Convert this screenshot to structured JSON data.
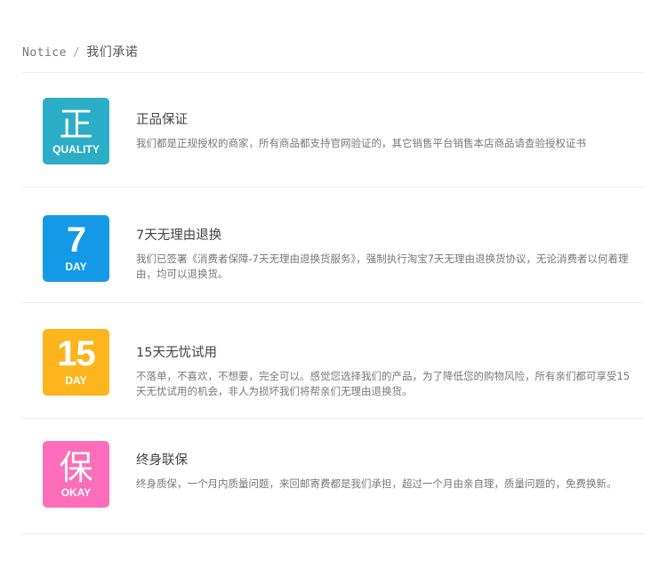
{
  "header": {
    "en": "Notice",
    "sep": "/",
    "cn": "我们承诺"
  },
  "promises": [
    {
      "badge_big": "正",
      "badge_small": "QUALITY",
      "color": "#2BADC6",
      "title": "正品保证",
      "desc": "我们都是正规授权的商家，所有商品都支持官网验证的，其它销售平台销售本店商品请查验授权证书"
    },
    {
      "badge_big": "7",
      "badge_small": "DAY",
      "color": "#1499E6",
      "title": "7天无理由退换",
      "desc": "我们已签署《消费者保障-7天无理由退换货服务》，强制执行淘宝7天无理由退换货协议，无论消费者以何着理由，均可以退换货。"
    },
    {
      "badge_big": "15",
      "badge_small": "DAY",
      "color": "#FDB51E",
      "title": "15天无忧试用",
      "desc": "不落单，不喜欢，不想要，完全可以。感觉您选择我们的产品，为了降低您的购物风险，所有亲们都可享受15天无忧试用的机会，非人为损坏我们将帮亲们无理由退换货。"
    },
    {
      "badge_big": "保",
      "badge_small": "OKAY",
      "color": "#FC6EB9",
      "title": "终身联保",
      "desc": "终身质保，一个月内质量问题，来回邮寄费都是我们承担，超过一个月由亲自理，质量问题的，免费换新。"
    }
  ]
}
